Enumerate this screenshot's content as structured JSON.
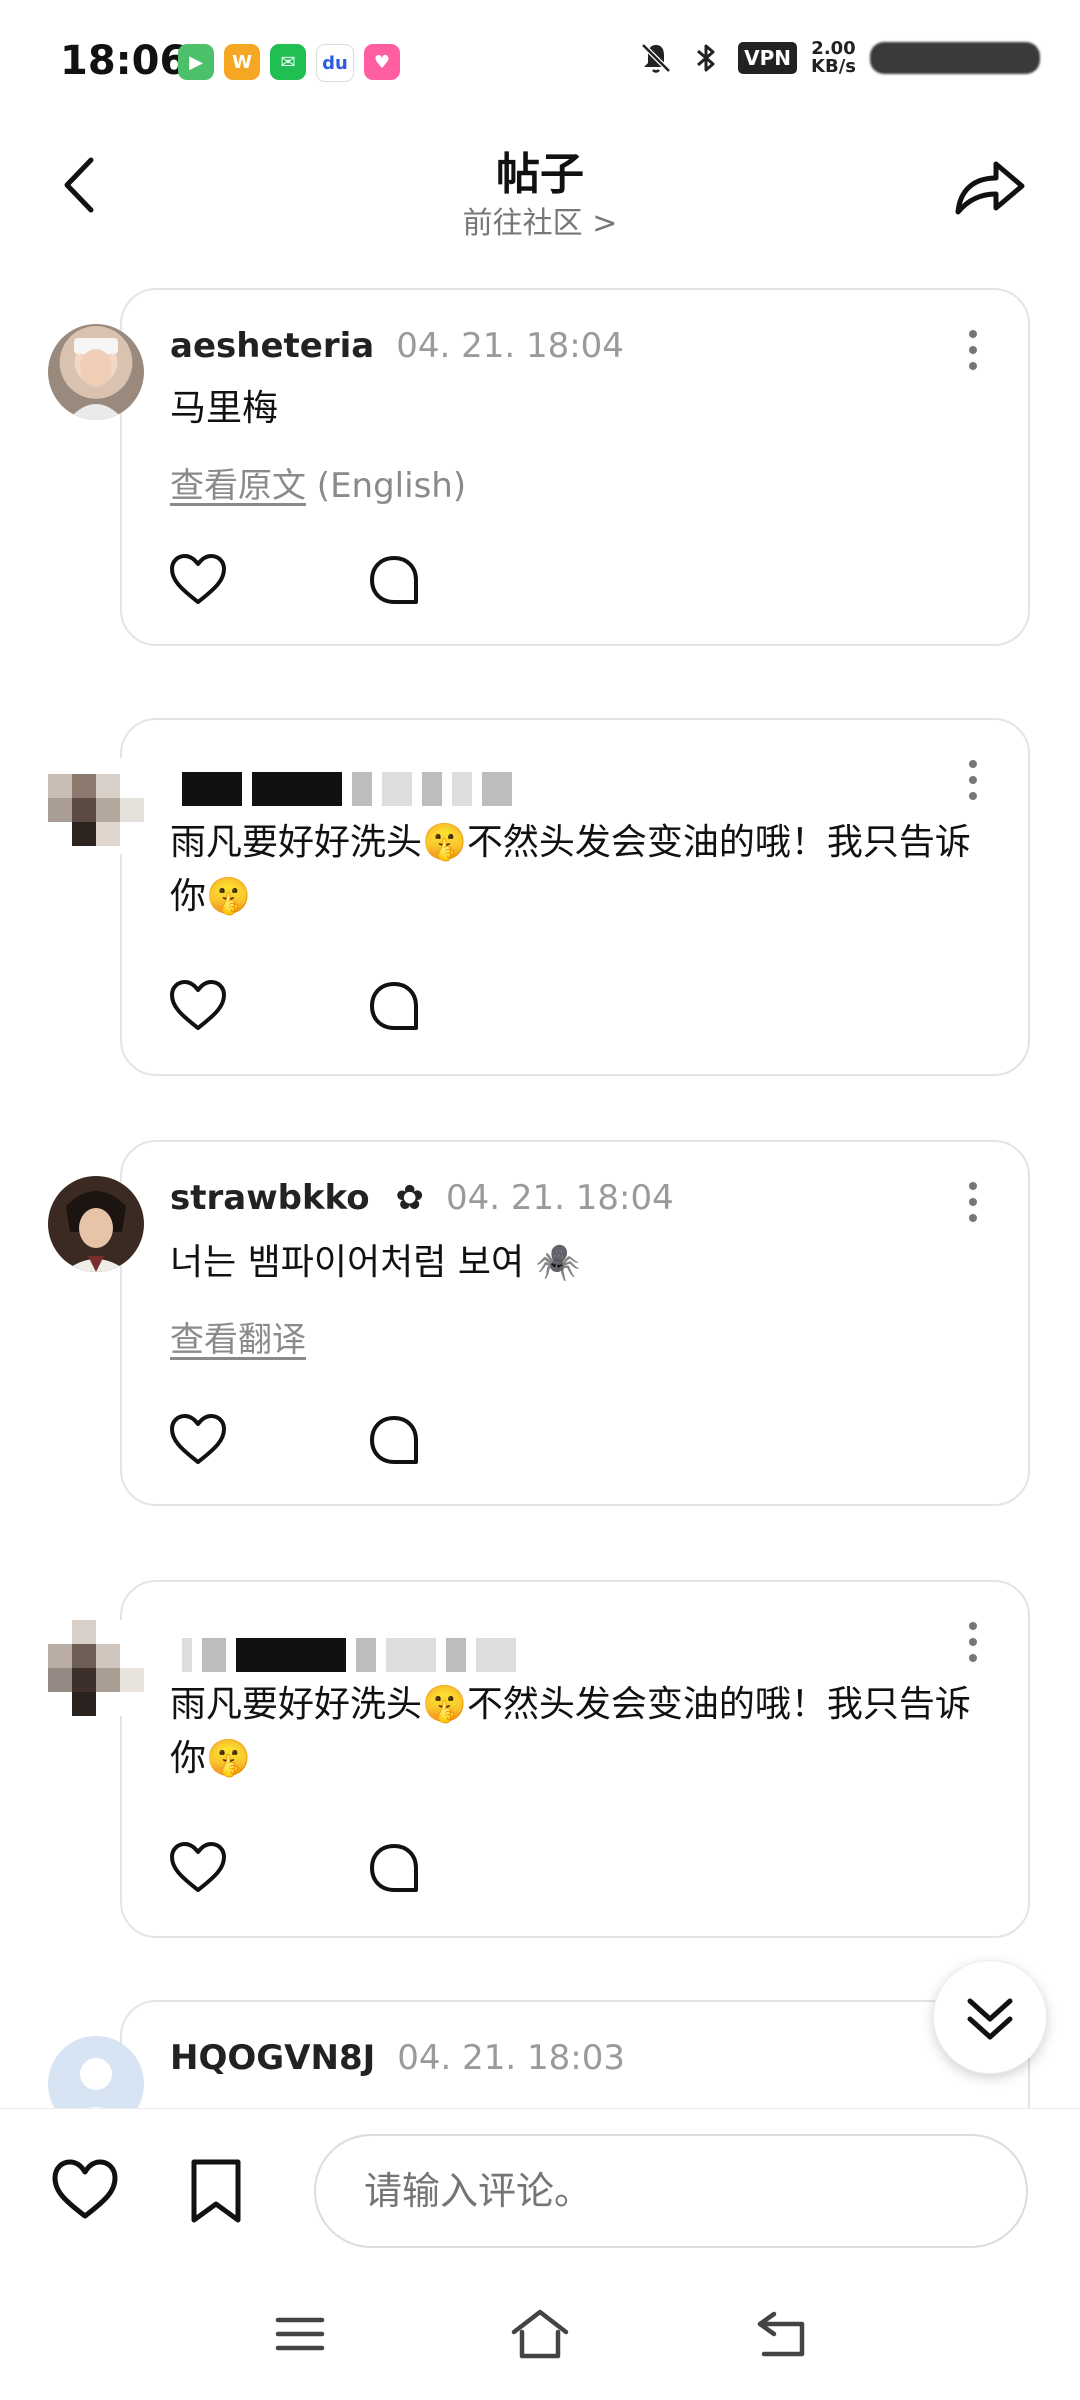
{
  "status_bar": {
    "time": "18:06",
    "vpn": "VPN",
    "net_speed_value": "2.00",
    "net_speed_unit": "KB/s",
    "app_icons": [
      "video-app-icon",
      "weibo-icon",
      "wechat-icon",
      "baidu-icon",
      "pink-app-icon"
    ]
  },
  "header": {
    "title": "帖子",
    "subtitle": "前往社区 >"
  },
  "comments": [
    {
      "user": "aesheteria",
      "time": "04. 21. 18:04",
      "text": "马里梅",
      "translate_link": "查看原文",
      "translate_lang": " (English)"
    },
    {
      "user": "",
      "time": "",
      "text": "雨凡要好好洗头🤫不然头发会变油的哦！我只告诉你🤫"
    },
    {
      "user": "strawbkko",
      "badge": "✿",
      "time": "04. 21. 18:04",
      "text": "너는 뱀파이어처럼 보여 🕷️",
      "translate_link": "查看翻译"
    },
    {
      "user": "",
      "time": "",
      "text": "雨凡要好好洗头🤫不然头发会变油的哦！我只告诉你🤫"
    },
    {
      "user": "HQOGVN8J",
      "time": "04. 21. 18:03"
    }
  ],
  "input_bar": {
    "placeholder": "请输入评论。"
  }
}
